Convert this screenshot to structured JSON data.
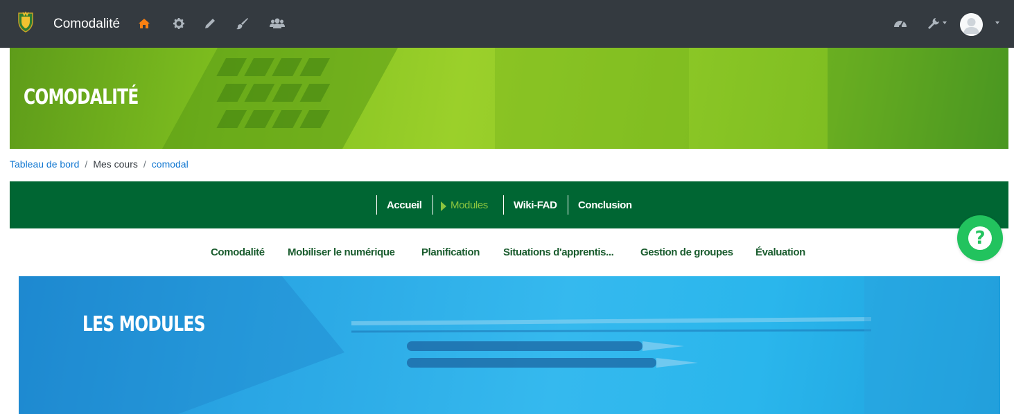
{
  "navbar": {
    "site_name": "Comodalité",
    "icons": [
      "home-icon",
      "gear-icon",
      "pencil-icon",
      "brush-icon",
      "users-icon"
    ],
    "right_icons": [
      "dashboard-icon",
      "wrench-icon",
      "avatar"
    ]
  },
  "banner": {
    "title": "COMODALITÉ"
  },
  "breadcrumb": {
    "items": [
      "Tableau de bord",
      "Mes cours",
      "comodal"
    ],
    "separator": "/"
  },
  "course_menu": {
    "items": [
      "Accueil",
      "Modules",
      "Wiki-FAD",
      "Conclusion"
    ],
    "active_item": "Modules"
  },
  "sub_menu": {
    "items": [
      "Comodalité",
      "Mobiliser le numérique",
      "Planification",
      "Situations d'apprentis...",
      "Gestion de groupes",
      "Évaluation"
    ]
  },
  "help": {
    "glyph": "?"
  },
  "modules_banner": {
    "title": "LES MODULES"
  },
  "colors": {
    "navbar": "#343a40",
    "course_menu": "#006633",
    "active_menu": "#8bc53f",
    "sub_menu_text": "#1a5c2e",
    "link": "#1177d1",
    "help_button": "#22c35e",
    "home_icon": "#f98012"
  }
}
